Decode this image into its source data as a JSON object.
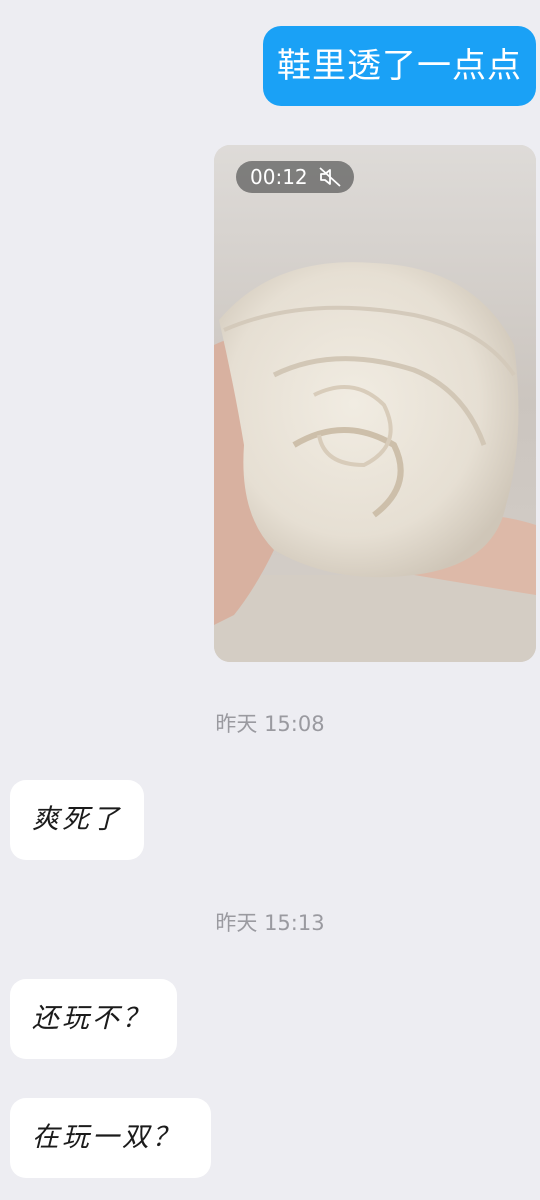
{
  "messages": {
    "outgoing_text": "鞋里透了一点点",
    "video": {
      "duration": "00:12",
      "muted": true,
      "icon": "mute-icon"
    },
    "timestamp_1": "昨天 15:08",
    "incoming_1": "爽死了",
    "timestamp_2": "昨天 15:13",
    "incoming_2": "还玩不？",
    "incoming_3": "在玩一双？"
  },
  "colors": {
    "background": "#ededf2",
    "outgoing_bubble": "#1aa1f6",
    "incoming_bubble": "#ffffff",
    "timestamp": "#9a9aa0"
  }
}
